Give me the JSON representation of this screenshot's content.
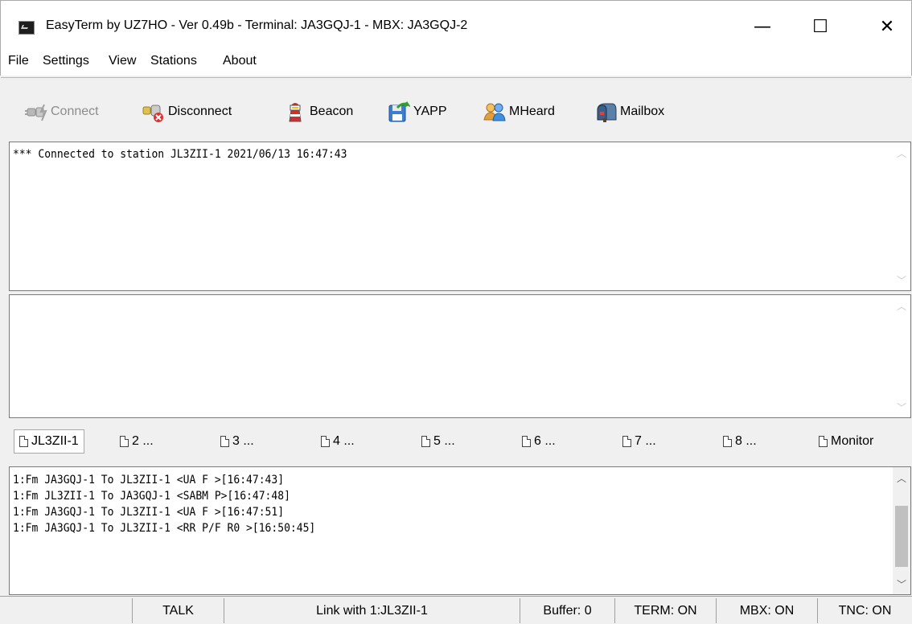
{
  "window": {
    "title": "EasyTerm by UZ7HO - Ver 0.49b - Terminal: JA3GQJ-1 - MBX: JA3GQJ-2",
    "minimize_glyph": "—",
    "maximize_glyph": "☐",
    "close_glyph": "✕"
  },
  "menu": {
    "items": [
      "File",
      "Settings",
      "View",
      "Stations",
      "About"
    ]
  },
  "toolbar": {
    "connect": {
      "label": "Connect",
      "icon": "connect-icon",
      "enabled": false
    },
    "disconnect": {
      "label": "Disconnect",
      "icon": "disconnect-icon"
    },
    "beacon": {
      "label": "Beacon",
      "icon": "lighthouse-icon"
    },
    "yapp": {
      "label": "YAPP",
      "icon": "floppy-arrow-icon"
    },
    "mheard": {
      "label": "MHeard",
      "icon": "users-icon"
    },
    "mailbox": {
      "label": "Mailbox",
      "icon": "mailbox-icon"
    }
  },
  "terminal": {
    "lines": [
      "*** Connected to station JL3ZII-1 2021/06/13 16:47:43"
    ]
  },
  "input_area": {
    "lines": []
  },
  "tabs": [
    {
      "label": "JL3ZII-1",
      "active": true
    },
    {
      "label": "2 ...",
      "active": false
    },
    {
      "label": "3 ...",
      "active": false
    },
    {
      "label": "4 ...",
      "active": false
    },
    {
      "label": "5 ...",
      "active": false
    },
    {
      "label": "6 ...",
      "active": false
    },
    {
      "label": "7 ...",
      "active": false
    },
    {
      "label": "8 ...",
      "active": false
    },
    {
      "label": "Monitor",
      "active": false
    }
  ],
  "monitor": {
    "lines": [
      "1:Fm JA3GQJ-1 To JL3ZII-1 <UA F >[16:47:43]",
      "1:Fm JL3ZII-1 To JA3GQJ-1 <SABM P>[16:47:48]",
      "1:Fm JA3GQJ-1 To JL3ZII-1 <UA F >[16:47:51]",
      "1:Fm JA3GQJ-1 To JL3ZII-1 <RR P/F R0 >[16:50:45]"
    ]
  },
  "status": {
    "mode": "TALK",
    "link": "Link with 1:JL3ZII-1",
    "buffer": "Buffer: 0",
    "term": "TERM: ON",
    "mbx": "MBX: ON",
    "tnc": "TNC: ON"
  },
  "colors": {
    "window_bg": "#f0f0f0",
    "pane_bg": "#ffffff",
    "disabled_text": "#8c8c8c"
  }
}
